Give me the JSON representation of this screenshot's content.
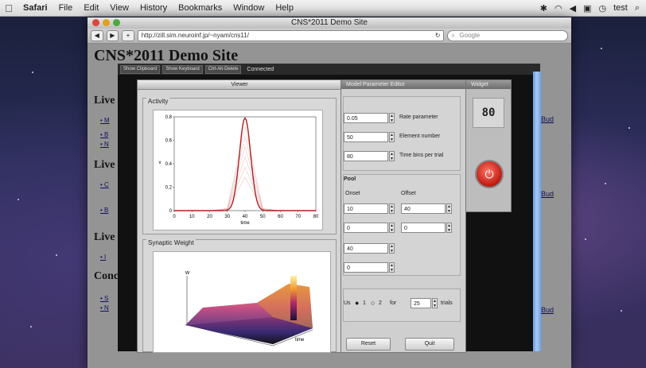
{
  "menubar": {
    "app": "Safari",
    "items": [
      "File",
      "Edit",
      "View",
      "History",
      "Bookmarks",
      "Window",
      "Help"
    ],
    "user": "test"
  },
  "browser": {
    "window_title": "CNS*2011 Demo Site",
    "url": "http://zill.sim.neuroinf.jp/~nyam/cns11/",
    "search_placeholder": "Google"
  },
  "site": {
    "title": "CNS*2011 Demo Site",
    "sections": [
      "Live S",
      "Live S",
      "Live S",
      "Conc"
    ],
    "right_links": [
      "Bud",
      "Bud",
      "Bud"
    ]
  },
  "lightbox": {
    "buttons": [
      "Show Clipboard",
      "Show Keyboard",
      "Ctrl-Alt-Delete"
    ],
    "status": "Connected"
  },
  "viewer": {
    "title": "Viewer",
    "activity_label": "Activity",
    "activity_xlabel": "time",
    "activity_ylabel": "v",
    "weight_label": "Synaptic Weight",
    "weight_axis_label": "time"
  },
  "chart_data": {
    "type": "line",
    "x": [
      0,
      10,
      20,
      30,
      40,
      50,
      60,
      70,
      80
    ],
    "xlim": [
      0,
      80
    ],
    "ylim": [
      0,
      0.8
    ],
    "yticks": [
      0,
      0.2,
      0.4,
      0.6,
      0.8
    ],
    "series": [
      {
        "values": [
          0,
          0,
          0,
          0.02,
          0.79,
          0.02,
          0,
          0,
          0
        ]
      }
    ]
  },
  "params": {
    "title": "Model Parameter Editor",
    "rate_value": "0.05",
    "rate_label": "Rate parameter",
    "element_value": "50",
    "element_label": "Element number",
    "timebins_value": "80",
    "timebins_label": "Time bins per trial",
    "group_label": "Pool",
    "onset_label": "Onset",
    "offset_label": "Offset",
    "onset_1": "10",
    "offset_1": "40",
    "onset_2": "0",
    "offset_2": "0",
    "field_3": "40",
    "field_4": "0",
    "trial_prefix": "Us",
    "opt_1": "1",
    "opt_2": "2",
    "for_label": "for",
    "trials_value": "25",
    "trials_label": "trials",
    "reset_label": "Reset",
    "quit_label": "Quit"
  },
  "widget": {
    "title": "Widget",
    "counter": "80"
  }
}
